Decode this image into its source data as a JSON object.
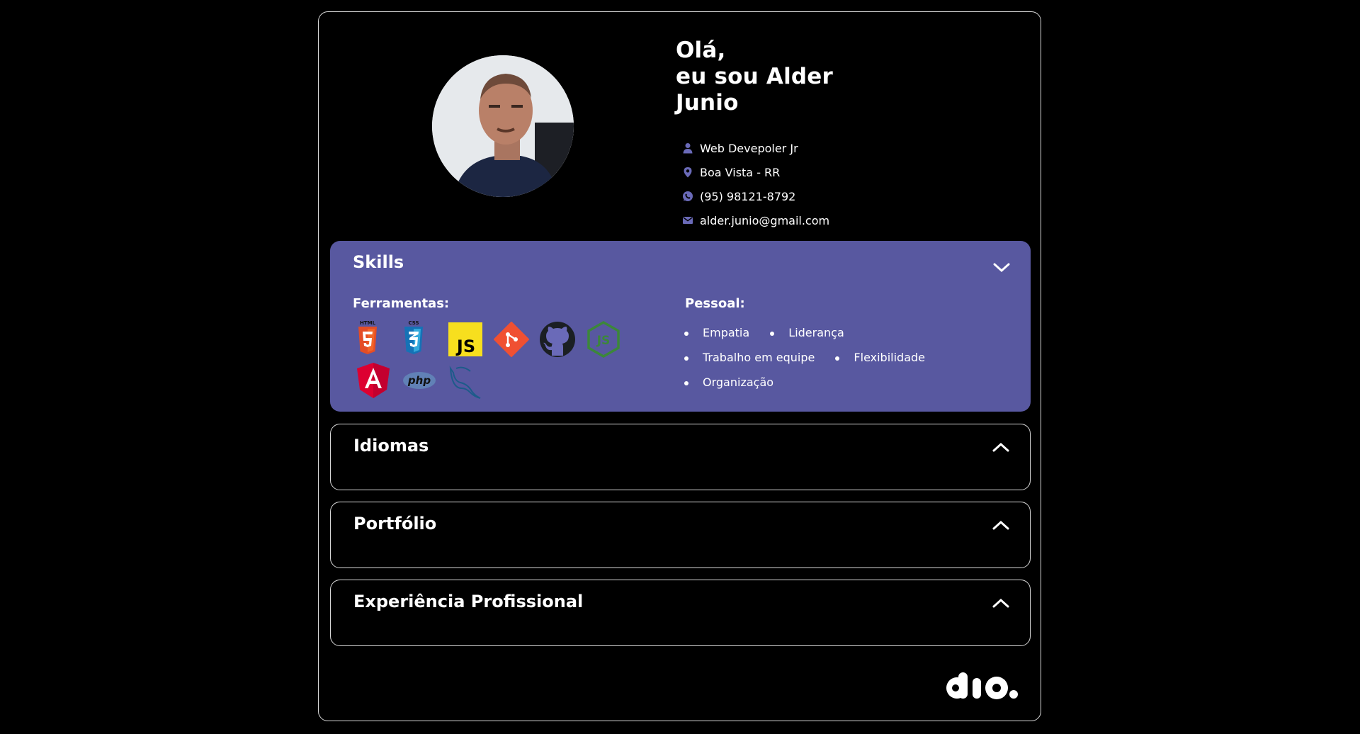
{
  "profile": {
    "greeting_line1": "Olá,",
    "greeting_line2": "eu sou Alder",
    "greeting_line3": "Junio",
    "photo_icon": "avatar-photo",
    "details": [
      {
        "icon": "person-icon",
        "text": "Web Devepoler Jr"
      },
      {
        "icon": "location-pin-icon",
        "text": "Boa Vista - RR"
      },
      {
        "icon": "whatsapp-icon",
        "text": "(95) 98121-8792"
      },
      {
        "icon": "email-icon",
        "text": "alder.junio@gmail.com"
      }
    ]
  },
  "colors": {
    "accent": "#5858a0",
    "icon_purple": "#6a6ab8",
    "background": "#000000",
    "border": "#d8d8d8"
  },
  "skills": {
    "title": "Skills",
    "state": "expanded",
    "tools_title": "Ferramentas:",
    "tools": [
      "html5-icon",
      "css3-icon",
      "javascript-icon",
      "git-icon",
      "github-icon",
      "nodejs-icon",
      "angular-icon",
      "php-icon",
      "mysql-icon"
    ],
    "tool_labels": {
      "html5": "HTML",
      "css3": "CSS",
      "javascript": "JS",
      "php": "php"
    },
    "personal_title": "Pessoal:",
    "personal": [
      "Empatia",
      "Liderança",
      "Trabalho em equipe",
      "Flexibilidade",
      "Organização"
    ]
  },
  "sections": [
    {
      "title": "Idiomas",
      "state": "collapsed"
    },
    {
      "title": "Portfólio",
      "state": "collapsed"
    },
    {
      "title": "Experiência Profissional",
      "state": "collapsed"
    }
  ],
  "footer": {
    "logo": "dio-logo",
    "logo_text": "dio."
  }
}
